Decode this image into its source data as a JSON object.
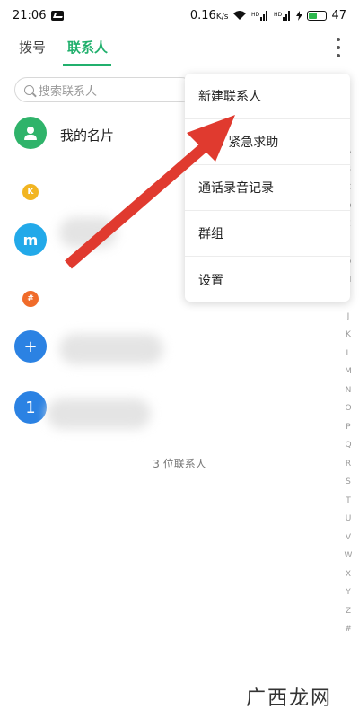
{
  "status_bar": {
    "time": "21:06",
    "speed": "0.16",
    "speed_unit": "K/s",
    "battery_level": "47",
    "battery_fraction": 0.47
  },
  "tabs": [
    {
      "label": "拨号",
      "active": false
    },
    {
      "label": "联系人",
      "active": true
    }
  ],
  "accent_color": "#21b06d",
  "search": {
    "placeholder": "搜索联系人"
  },
  "my_card": {
    "label": "我的名片"
  },
  "sections": [
    {
      "letter": "K",
      "color": "#f2b521",
      "contacts": [
        {
          "avatar": "m",
          "color": "#22a9e9"
        }
      ]
    },
    {
      "letter": "#",
      "color": "#f06b2a",
      "contacts": [
        {
          "avatar": "+",
          "color": "#2b82e3"
        },
        {
          "avatar": "1",
          "color": "#2b82e3"
        }
      ]
    }
  ],
  "contact_count": "3 位联系人",
  "alphabet": [
    "A",
    "B",
    "C",
    "D",
    "E",
    "F",
    "G",
    "H",
    "I",
    "J",
    "K",
    "L",
    "M",
    "N",
    "O",
    "P",
    "Q",
    "R",
    "S",
    "T",
    "U",
    "V",
    "W",
    "X",
    "Y",
    "Z",
    "#"
  ],
  "menu": {
    "items": [
      "新建联系人",
      "SOS 紧急求助",
      "通话录音记录",
      "群组",
      "设置"
    ]
  },
  "watermark": "广西龙网",
  "icons": {
    "message": "message-icon",
    "wifi": "wifi-icon",
    "signal": "signal-icon",
    "battery": "battery-icon",
    "more": "more-vertical-icon",
    "search": "search-icon",
    "person": "person-icon",
    "annotation_arrow": "red-arrow-icon"
  }
}
